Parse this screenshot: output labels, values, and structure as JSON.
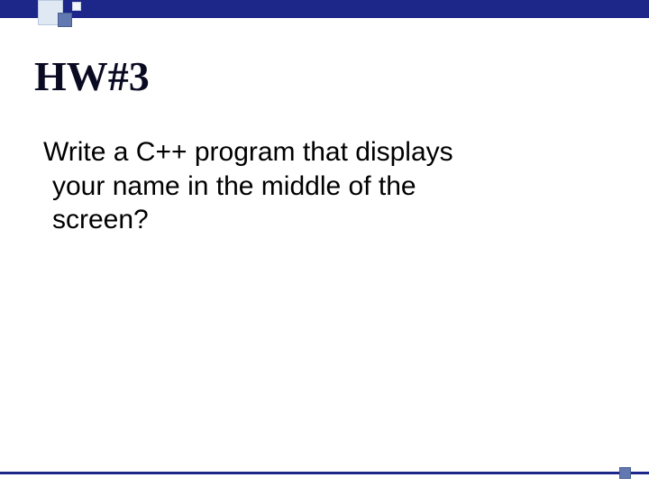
{
  "slide": {
    "title": "HW#3",
    "body_line1": "Write a C++ program that displays",
    "body_line2": "your name in the middle of the",
    "body_line3": "screen?"
  }
}
